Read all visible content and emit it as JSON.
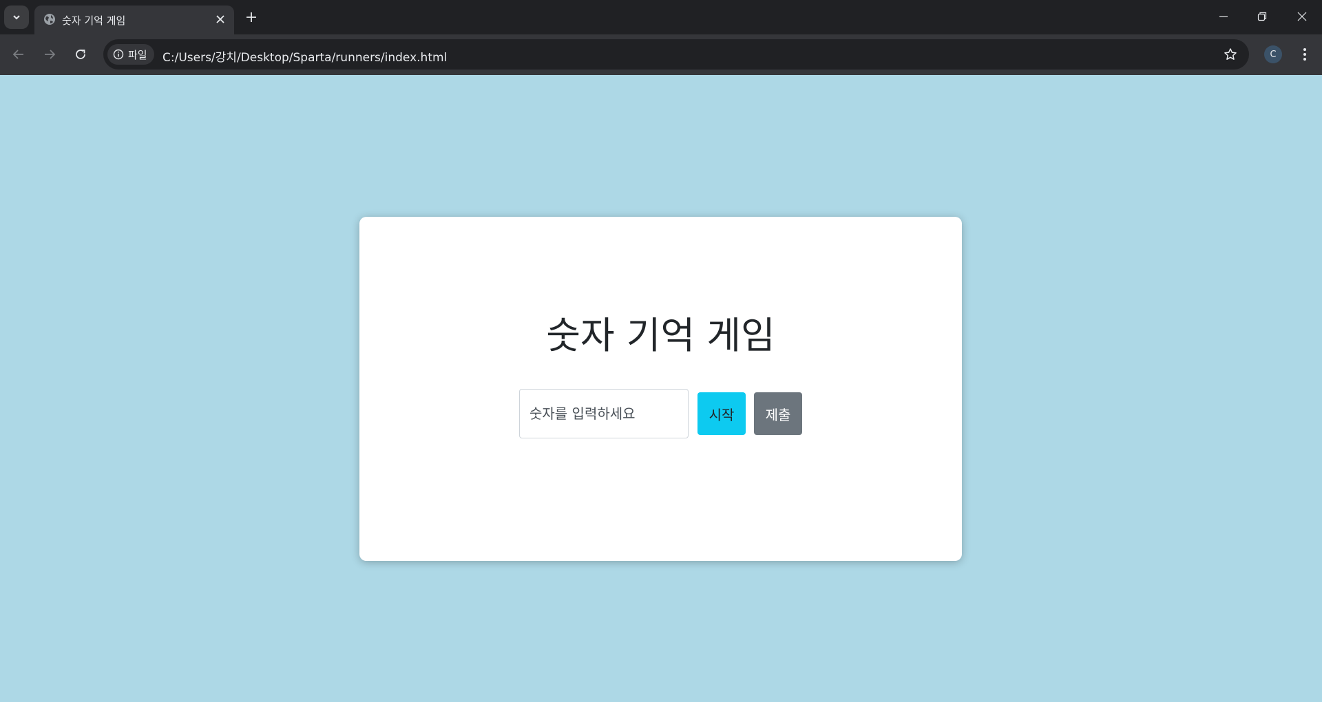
{
  "browser": {
    "tab_title": "숫자 기억 게임",
    "site_chip_label": "파일",
    "url": "C:/Users/강치/Desktop/Sparta/runners/index.html",
    "profile_initial": "C"
  },
  "page": {
    "background_color": "#add8e6",
    "heading": "숫자 기억 게임",
    "input_placeholder": "숫자를 입력하세요",
    "start_label": "시작",
    "submit_label": "제출",
    "start_color": "#0dcaf0",
    "submit_color": "#6c757d"
  }
}
